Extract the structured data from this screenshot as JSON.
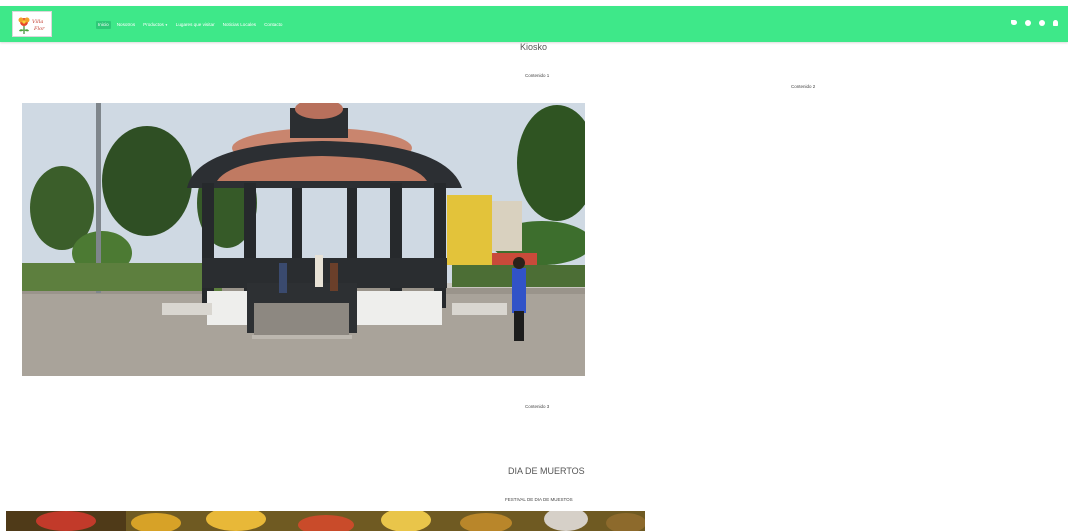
{
  "navbar": {
    "background": "#3ee889",
    "logo_alt": "Villa Florece logo",
    "links": [
      {
        "label": "Inicio",
        "active": true
      },
      {
        "label": "Nosotros"
      },
      {
        "label": "Productos"
      },
      {
        "label": "Lugares que visitar"
      },
      {
        "label": "Noticias Locales"
      },
      {
        "label": "Contacto"
      }
    ],
    "social_icons": [
      "twitter-icon",
      "facebook-icon",
      "instagram-icon",
      "user-icon"
    ]
  },
  "kiosko": {
    "title": "Kiosko",
    "contenido1": "Contenido 1",
    "contenido2": "Contenido 2",
    "contenido3": "Contenido 3"
  },
  "muertos": {
    "title": "DIA DE MUERTOS",
    "subtitle": "FESTIVAL DE DIA DE MUESTOS"
  }
}
